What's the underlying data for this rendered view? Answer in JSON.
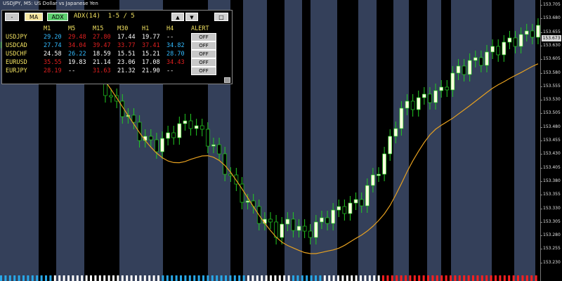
{
  "chart": {
    "title": "USDJPY, M5: US Dollar vs Japanese Yen",
    "colors": {
      "background": "#000000",
      "shade": "#34405a",
      "bull": "#ffffe0",
      "bear": "#000000",
      "wick": "#22cc22",
      "ma": "#e6a020"
    },
    "price_axis": {
      "ticks": [
        "153.705",
        "153.680",
        "153.655",
        "153.630",
        "153.605",
        "153.580",
        "153.555",
        "153.530",
        "153.505",
        "153.480",
        "153.455",
        "153.430",
        "153.405",
        "153.380",
        "153.355",
        "153.330",
        "153.305",
        "153.280",
        "153.255",
        "153.230"
      ],
      "current_price": "153.673"
    }
  },
  "panel": {
    "toolbar": {
      "minimize_label": "-",
      "ma_label": "MA",
      "adx_label": "ADX",
      "indicator_label": "ADX(14)",
      "page_label": "1-5 / 5",
      "up_label": "▲",
      "down_label": "▼",
      "close_label": "□"
    },
    "headers": [
      "M1",
      "M5",
      "M15",
      "M30",
      "H1",
      "H4",
      "ALERT"
    ],
    "rows": [
      {
        "symbol": "USDJPY",
        "values": [
          {
            "text": "29.20",
            "color": "#33bbff"
          },
          {
            "text": "29.48",
            "color": "#e02020"
          },
          {
            "text": "27.80",
            "color": "#e02020"
          },
          {
            "text": "17.44",
            "color": "#ffffff"
          },
          {
            "text": "19.77",
            "color": "#ffffff"
          },
          {
            "text": "--",
            "color": "#ffffff"
          }
        ],
        "alert": "OFF"
      },
      {
        "symbol": "USDCAD",
        "values": [
          {
            "text": "27.74",
            "color": "#33bbff"
          },
          {
            "text": "34.04",
            "color": "#e02020"
          },
          {
            "text": "39.47",
            "color": "#e02020"
          },
          {
            "text": "33.77",
            "color": "#e02020"
          },
          {
            "text": "37.41",
            "color": "#e02020"
          },
          {
            "text": "34.82",
            "color": "#33bbff"
          }
        ],
        "alert": "OFF"
      },
      {
        "symbol": "USDCHF",
        "values": [
          {
            "text": "24.58",
            "color": "#ffffff"
          },
          {
            "text": "26.22",
            "color": "#33bbff"
          },
          {
            "text": "18.59",
            "color": "#ffffff"
          },
          {
            "text": "15.51",
            "color": "#ffffff"
          },
          {
            "text": "15.21",
            "color": "#ffffff"
          },
          {
            "text": "28.70",
            "color": "#33bbff"
          }
        ],
        "alert": "OFF"
      },
      {
        "symbol": "EURUSD",
        "values": [
          {
            "text": "35.55",
            "color": "#e02020"
          },
          {
            "text": "19.83",
            "color": "#ffffff"
          },
          {
            "text": "21.14",
            "color": "#ffffff"
          },
          {
            "text": "23.06",
            "color": "#ffffff"
          },
          {
            "text": "17.08",
            "color": "#ffffff"
          },
          {
            "text": "34.43",
            "color": "#e02020"
          }
        ],
        "alert": "OFF"
      },
      {
        "symbol": "EURJPY",
        "values": [
          {
            "text": "28.19",
            "color": "#e02020"
          },
          {
            "text": "--",
            "color": "#ffffff"
          },
          {
            "text": "31.63",
            "color": "#e02020"
          },
          {
            "text": "21.32",
            "color": "#ffffff"
          },
          {
            "text": "21.90",
            "color": "#ffffff"
          },
          {
            "text": "--",
            "color": "#ffffff"
          }
        ],
        "alert": "OFF"
      }
    ]
  }
}
